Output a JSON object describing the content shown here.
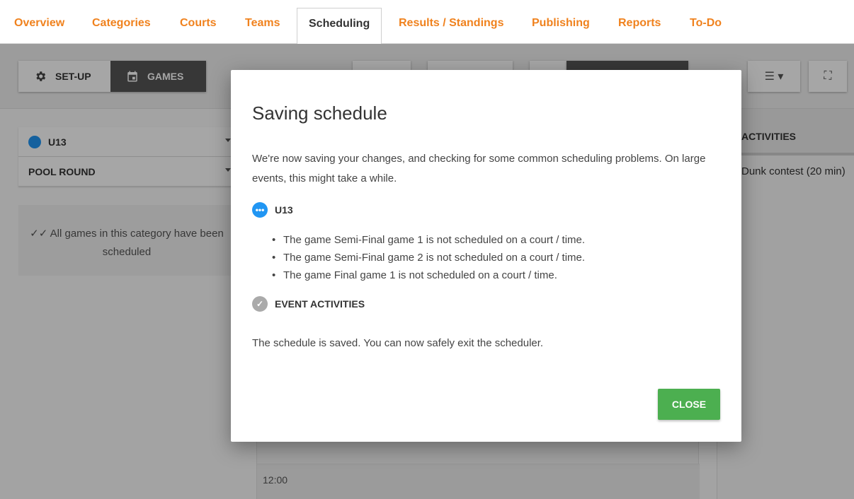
{
  "tabs": [
    {
      "label": "Overview"
    },
    {
      "label": "Categories"
    },
    {
      "label": "Courts"
    },
    {
      "label": "Teams"
    },
    {
      "label": "Scheduling"
    },
    {
      "label": "Results / Standings"
    },
    {
      "label": "Publishing"
    },
    {
      "label": "Reports"
    },
    {
      "label": "To-Do"
    }
  ],
  "active_tab": "Scheduling",
  "toolbar": {
    "setup_label": "SET-UP",
    "games_label": "GAMES"
  },
  "left_panel": {
    "category": "U13",
    "round": "POOL ROUND",
    "scheduled_msg": "All games in this category have been scheduled"
  },
  "activities": {
    "header": "ACTIVITIES",
    "item": "Dunk contest (20 min)"
  },
  "grid": {
    "time": "12:00"
  },
  "modal": {
    "title": "Saving schedule",
    "intro": "We're now saving your changes, and checking for some common scheduling problems. On large events, this might take a while.",
    "categories": [
      {
        "name": "U13",
        "status": "in-progress",
        "issues": [
          "The game Semi-Final game 1 is not scheduled on a court / time.",
          "The game Semi-Final game 2 is not scheduled on a court / time.",
          "The game Final game 1 is not scheduled on a court / time."
        ]
      },
      {
        "name": "EVENT ACTIVITIES",
        "status": "done"
      }
    ],
    "saved_msg": "The schedule is saved. You can now safely exit the scheduler.",
    "close_label": "CLOSE"
  },
  "colors": {
    "tab_accent": "#f0821e",
    "close_button": "#4caf50",
    "category_dot": "#2196f3"
  }
}
